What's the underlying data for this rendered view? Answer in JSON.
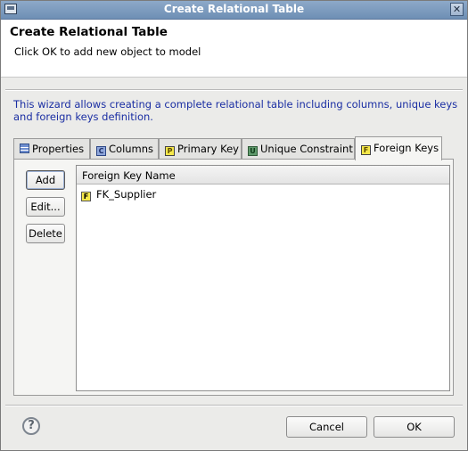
{
  "window": {
    "title": "Create Relational Table",
    "close_glyph": "✕"
  },
  "header": {
    "title": "Create Relational Table",
    "message": "Click OK to add new object to model"
  },
  "description": "This wizard allows creating a complete relational table including columns, unique keys and foreign keys definition.",
  "tabs": [
    {
      "label": "Properties",
      "icon": "table-icon",
      "active": false
    },
    {
      "label": "Columns",
      "icon": "columns-icon",
      "icon_letter": "C",
      "active": false
    },
    {
      "label": "Primary Key",
      "icon": "primary-key-icon",
      "icon_letter": "P",
      "active": false
    },
    {
      "label": "Unique Constraint",
      "icon": "unique-constraint-icon",
      "icon_letter": "U",
      "active": false
    },
    {
      "label": "Foreign Keys",
      "icon": "foreign-key-icon",
      "icon_letter": "F",
      "active": true
    }
  ],
  "foreign_keys": {
    "buttons": {
      "add": "Add",
      "edit": "Edit...",
      "delete": "Delete"
    },
    "column_header": "Foreign Key Name",
    "rows": [
      {
        "name": "FK_Supplier",
        "icon_letter": "F"
      }
    ]
  },
  "footer": {
    "help_glyph": "?",
    "cancel": "Cancel",
    "ok": "OK"
  },
  "colors": {
    "titlebar": "#7b9abf",
    "description_text": "#1a2ea3",
    "key_icon": "#f6e84a"
  }
}
